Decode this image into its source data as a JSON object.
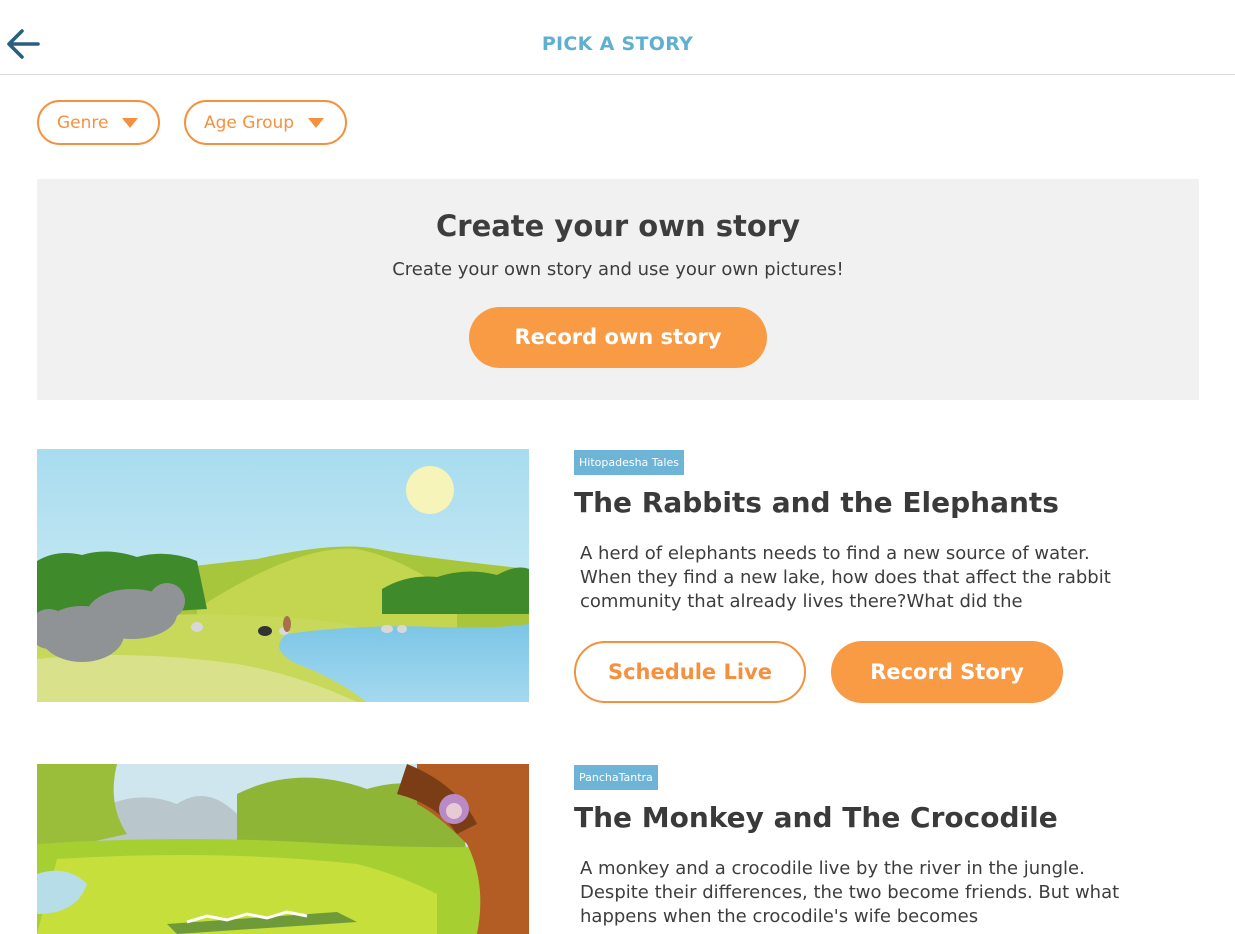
{
  "header": {
    "title": "PICK A STORY",
    "back_icon": "arrow-left-icon"
  },
  "filters": [
    {
      "label": "Genre",
      "icon": "caret-down-icon"
    },
    {
      "label": "Age Group",
      "icon": "caret-down-icon"
    }
  ],
  "create": {
    "title": "Create your own story",
    "subtitle": "Create your own story and use your own pictures!",
    "button_label": "Record own story"
  },
  "stories": [
    {
      "tag": "Hitopadesha Tales",
      "title": "The Rabbits and the Elephants",
      "description": "A herd of elephants needs to find a new source of water. When they find a new lake, how does that affect the rabbit community that already lives there?What did the",
      "schedule_label": "Schedule Live",
      "record_label": "Record Story"
    },
    {
      "tag": "PanchaTantra",
      "title": "The Monkey and The Crocodile",
      "description": "A monkey and a crocodile live by the river in the jungle. Despite their differences, the two become friends. But what happens when the crocodile's wife becomes"
    }
  ],
  "colors": {
    "accent_orange": "#f99b45",
    "title_blue": "#5fb0d0",
    "tag_blue": "#6db4d6",
    "panel_gray": "#f1f1f1"
  }
}
